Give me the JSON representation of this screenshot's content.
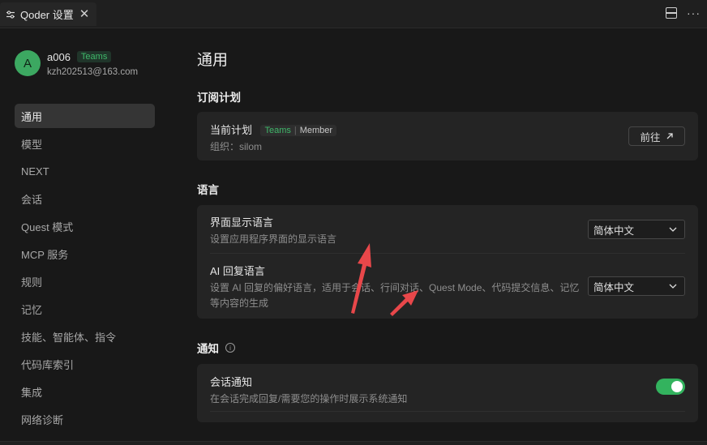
{
  "tab": {
    "title": "Qoder 设置",
    "icon": "settings-sliders-icon",
    "close_icon": "close-icon"
  },
  "toolbar": {
    "split_icon": "split-editor-icon",
    "more_icon": "more-icon"
  },
  "user": {
    "avatar_letter": "A",
    "name": "a006",
    "badge": "Teams",
    "email": "kzh202513@163.com"
  },
  "sidebar": {
    "items": [
      {
        "label": "通用",
        "active": true
      },
      {
        "label": "模型"
      },
      {
        "label": "NEXT"
      },
      {
        "label": "会话"
      },
      {
        "label": "Quest 模式"
      },
      {
        "label": "MCP 服务"
      },
      {
        "label": "规则"
      },
      {
        "label": "记忆"
      },
      {
        "label": "技能、智能体、指令"
      },
      {
        "label": "代码库索引"
      },
      {
        "label": "集成"
      },
      {
        "label": "网络诊断"
      }
    ]
  },
  "main": {
    "title": "通用",
    "subscription": {
      "section_title": "订阅计划",
      "current_plan_label": "当前计划",
      "badge_teams": "Teams",
      "badge_member": "Member",
      "org": "组织：silom",
      "go_button": "前往"
    },
    "language": {
      "section_title": "语言",
      "ui_language": {
        "title": "界面显示语言",
        "desc": "设置应用程序界面的显示语言",
        "value": "简体中文"
      },
      "ai_language": {
        "title": "AI 回复语言",
        "desc": "设置 AI 回复的偏好语言，适用于会话、行间对话、Quest Mode、代码提交信息、记忆等内容的生成",
        "value": "简体中文"
      }
    },
    "notification": {
      "section_title": "通知",
      "session": {
        "title": "会话通知",
        "desc": "在会话完成回复/需要您的操作时展示系统通知",
        "enabled": true
      }
    }
  },
  "colors": {
    "accent_green": "#33b35e",
    "annotation_arrow": "#e8474a"
  }
}
